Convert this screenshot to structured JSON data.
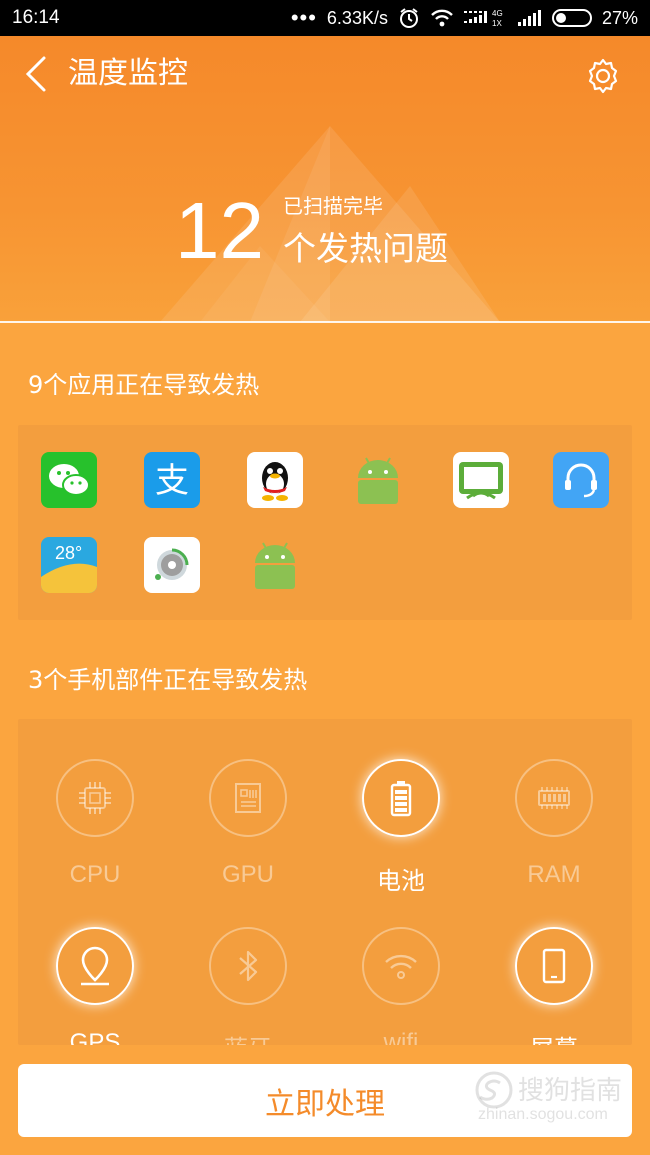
{
  "status_bar": {
    "time": "16:14",
    "network_speed": "6.33K/s",
    "battery_percent": "27%",
    "icons": [
      "dots-icon",
      "alarm-icon",
      "wifi-icon",
      "signal-4g-icon",
      "signal-icon",
      "battery-icon"
    ]
  },
  "header": {
    "title": "温度监控",
    "count": "12",
    "scan_status": "已扫描完毕",
    "issue_label": "个发热问题"
  },
  "apps_section": {
    "title": "9个应用正在导致发热",
    "apps": [
      {
        "name": "wechat-icon",
        "color": "#27c12c"
      },
      {
        "name": "alipay-icon",
        "color": "#1a9cea"
      },
      {
        "name": "qq-icon",
        "color": "#ffffff"
      },
      {
        "name": "android-icon",
        "color": "#8cc152"
      },
      {
        "name": "screen-cast-icon",
        "color": "#5cad3a"
      },
      {
        "name": "headset-support-icon",
        "color": "#42a5f5"
      },
      {
        "name": "weather-icon",
        "color": "#2aa8e0"
      },
      {
        "name": "cd-player-icon",
        "color": "#ffffff"
      },
      {
        "name": "android-icon",
        "color": "#8cc152"
      }
    ]
  },
  "parts_section": {
    "title": "3个手机部件正在导致发热",
    "parts": [
      {
        "label": "CPU",
        "icon": "cpu-icon",
        "active": false
      },
      {
        "label": "GPU",
        "icon": "gpu-icon",
        "active": false
      },
      {
        "label": "电池",
        "icon": "battery-icon",
        "active": true
      },
      {
        "label": "RAM",
        "icon": "ram-icon",
        "active": false
      },
      {
        "label": "GPS",
        "icon": "location-pin-icon",
        "active": true
      },
      {
        "label": "蓝牙",
        "icon": "bluetooth-icon",
        "active": false
      },
      {
        "label": "wifi",
        "icon": "wifi-icon",
        "active": false
      },
      {
        "label": "屏幕",
        "icon": "screen-icon",
        "active": true
      }
    ]
  },
  "action": {
    "label": "立即处理"
  },
  "watermark": {
    "text": "搜狗指南",
    "url": "zhinan.sogou.com"
  },
  "colors": {
    "header_top": "#f5892a",
    "body": "#fba53f",
    "button_text": "#f48b2a"
  }
}
